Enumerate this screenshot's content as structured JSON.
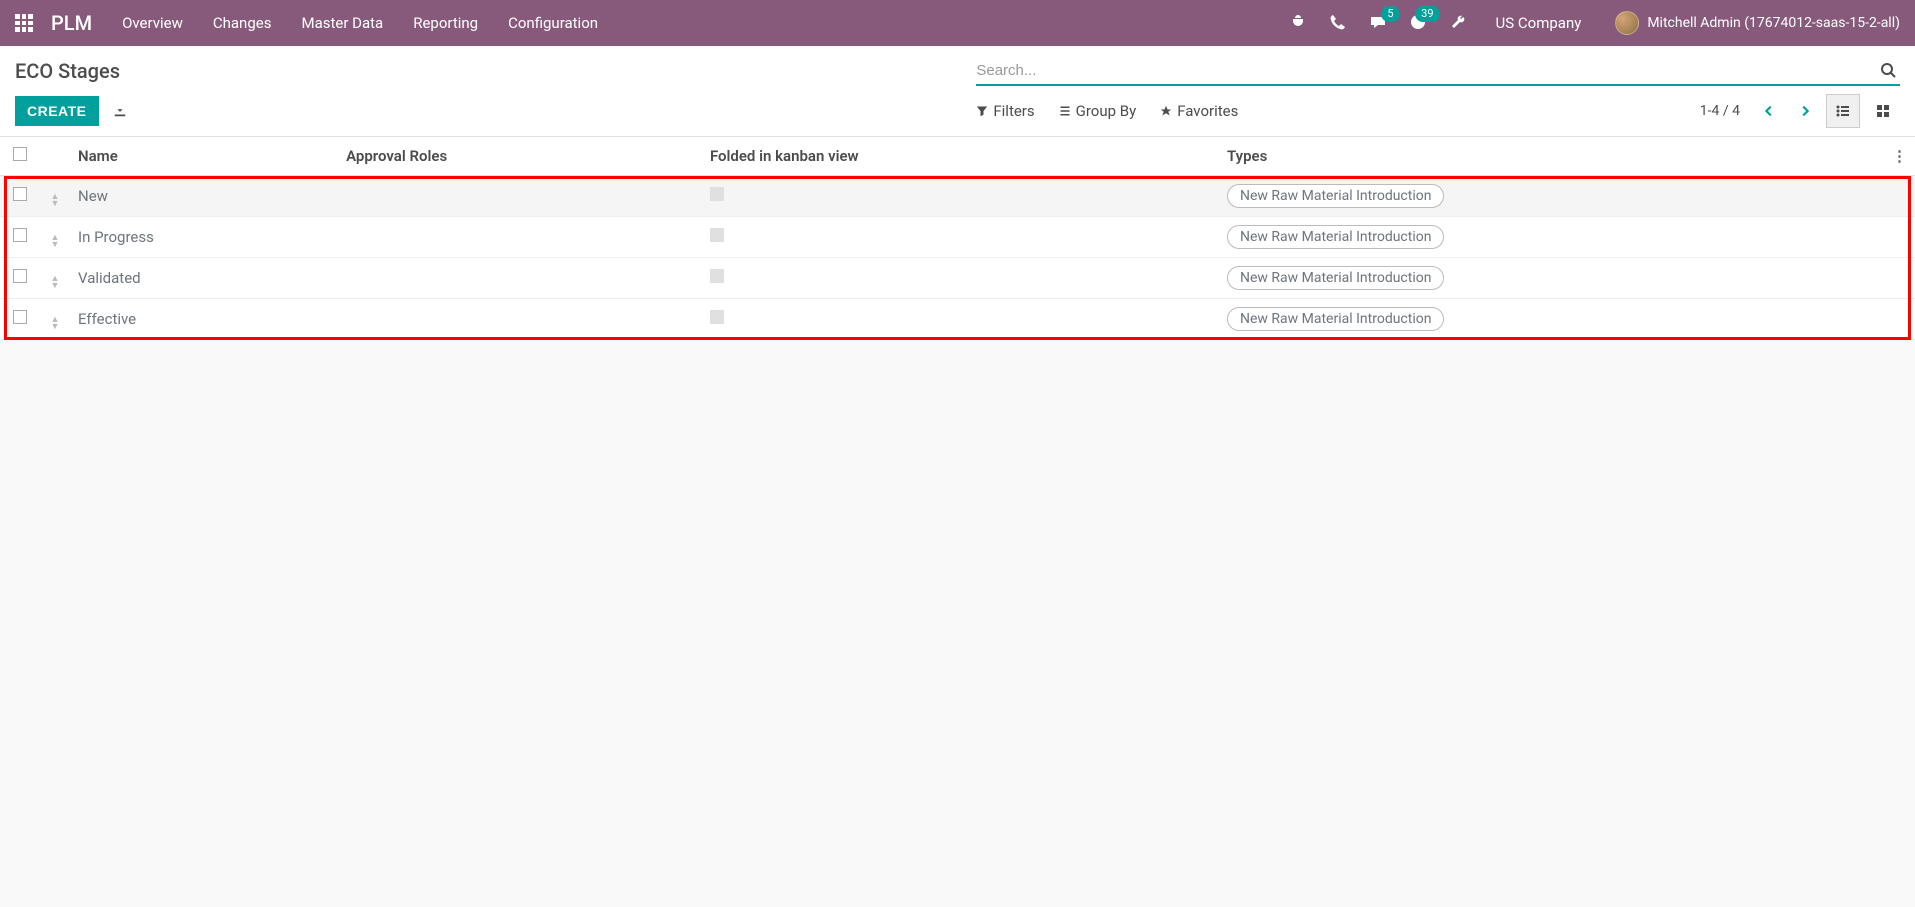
{
  "navbar": {
    "brand": "PLM",
    "menu": [
      "Overview",
      "Changes",
      "Master Data",
      "Reporting",
      "Configuration"
    ],
    "messages_badge": "5",
    "activities_badge": "39",
    "company": "US Company",
    "user": "Mitchell Admin (17674012-saas-15-2-all)"
  },
  "control_panel": {
    "title": "ECO Stages",
    "search_placeholder": "Search...",
    "create_label": "CREATE",
    "filters_label": "Filters",
    "groupby_label": "Group By",
    "favorites_label": "Favorites",
    "pager": "1-4 / 4"
  },
  "table": {
    "headers": {
      "name": "Name",
      "approval": "Approval Roles",
      "folded": "Folded in kanban view",
      "types": "Types"
    },
    "rows": [
      {
        "name": "New",
        "type_tag": "New Raw Material Introduction"
      },
      {
        "name": "In Progress",
        "type_tag": "New Raw Material Introduction"
      },
      {
        "name": "Validated",
        "type_tag": "New Raw Material Introduction"
      },
      {
        "name": "Effective",
        "type_tag": "New Raw Material Introduction"
      }
    ]
  }
}
